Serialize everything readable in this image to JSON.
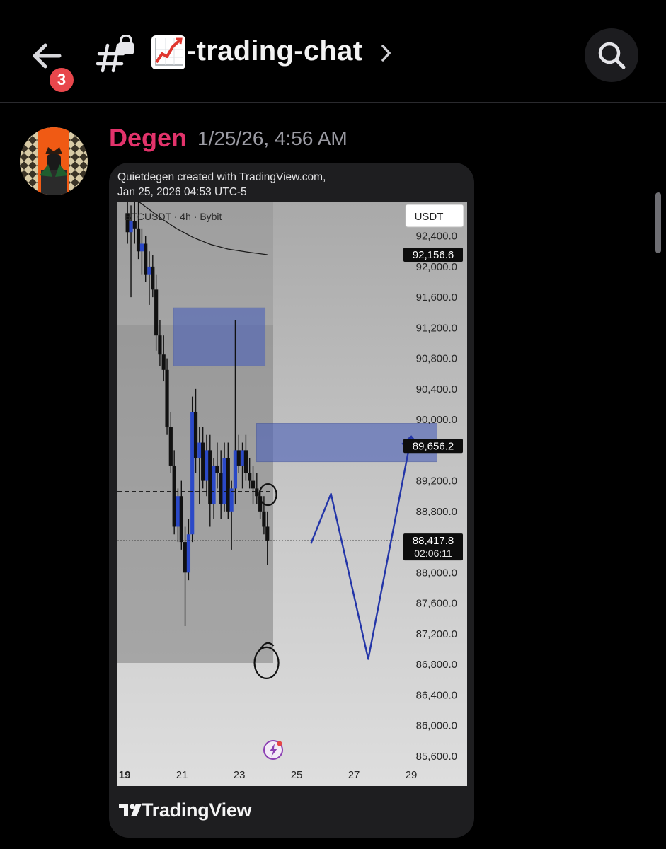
{
  "header": {
    "unread_count": "3",
    "channel_name": "-trading-chat",
    "channel_emoji": "chart-increasing-icon"
  },
  "message": {
    "author": "Degen",
    "timestamp": "1/25/26, 4:56 AM",
    "author_color": "#e2336b"
  },
  "embed": {
    "credit_line1": "Quietdegen created with TradingView.com,",
    "credit_line2": "Jan 25, 2026 04:53 UTC-5",
    "brand": "TradingView"
  },
  "chart_data": {
    "type": "candlestick",
    "symbol_line": "BTCUSDT · 4h · Bybit",
    "currency_button": "USDT",
    "y_ticks": [
      92400,
      92000,
      91600,
      91200,
      90800,
      90400,
      90000,
      89600,
      89200,
      88800,
      88000,
      87600,
      87200,
      86800,
      86400,
      86000,
      85600
    ],
    "y_tick_labels": [
      "92,400.0",
      "92,000.0",
      "91,600.0",
      "91,200.0",
      "90,800.0",
      "90,400.0",
      "90,000.0",
      "89,200.0",
      "88,800.0",
      "88,000.0",
      "87,600.0",
      "87,200.0",
      "86,800.0",
      "86,400.0",
      "86,000.0",
      "85,600.0"
    ],
    "x_labels": [
      "19",
      "21",
      "23",
      "25",
      "27",
      "29"
    ],
    "x_values": [
      19,
      21,
      23,
      25,
      27,
      29
    ],
    "ylim": [
      85450,
      92850
    ],
    "xlim": [
      18.75,
      30.95
    ],
    "moving_average_end": 92156.6,
    "price_labels": [
      {
        "value": "92,156.6",
        "price": 92156.6
      },
      {
        "value": "89,656.2",
        "price": 89656.2
      },
      {
        "value": "88,417.8",
        "price": 88417.8,
        "sub": "02:06:11"
      }
    ],
    "zones": [
      {
        "from_x": 20.7,
        "to_x": 23.9,
        "low": 90700,
        "high": 91460
      },
      {
        "from_x": 23.6,
        "to_x": 29.9,
        "low": 89450,
        "high": 89950
      }
    ],
    "dashed_level": 89060,
    "current_price": 88417.8,
    "projection": [
      [
        25.5,
        88380
      ],
      [
        26.2,
        89030
      ],
      [
        27.5,
        86870
      ],
      [
        29,
        89780
      ]
    ],
    "candles": [
      [
        19.1,
        92700,
        92900,
        92300,
        92450
      ],
      [
        19.22,
        92450,
        92800,
        91600,
        92600
      ],
      [
        19.35,
        92600,
        92900,
        92300,
        92500
      ],
      [
        19.48,
        92500,
        92900,
        92100,
        92200
      ],
      [
        19.6,
        92200,
        92500,
        91900,
        92300
      ],
      [
        19.73,
        92300,
        92400,
        91800,
        91900
      ],
      [
        19.86,
        91900,
        92200,
        91500,
        92000
      ],
      [
        19.98,
        92000,
        92150,
        91600,
        91700
      ],
      [
        20.1,
        91700,
        91900,
        90900,
        91100
      ],
      [
        20.23,
        91100,
        91300,
        90700,
        90850
      ],
      [
        20.36,
        90850,
        91100,
        90500,
        90650
      ],
      [
        20.48,
        90650,
        90800,
        89800,
        89900
      ],
      [
        20.61,
        89900,
        90100,
        89300,
        89400
      ],
      [
        20.73,
        89400,
        89600,
        88500,
        88600
      ],
      [
        20.86,
        88600,
        89100,
        88400,
        89000
      ],
      [
        20.98,
        89000,
        89200,
        88300,
        88400
      ],
      [
        21.11,
        88400,
        88600,
        87300,
        88000
      ],
      [
        21.23,
        88000,
        88700,
        87900,
        88500
      ],
      [
        21.36,
        88500,
        90300,
        88400,
        90100
      ],
      [
        21.48,
        90100,
        90400,
        89300,
        89500
      ],
      [
        21.61,
        89500,
        89900,
        88900,
        89700
      ],
      [
        21.73,
        89700,
        89900,
        89100,
        89200
      ],
      [
        21.86,
        89200,
        89800,
        89000,
        89600
      ],
      [
        21.98,
        89600,
        89800,
        88600,
        88900
      ],
      [
        22.11,
        88900,
        89500,
        88700,
        89400
      ],
      [
        22.23,
        89400,
        89700,
        89100,
        89300
      ],
      [
        22.36,
        89300,
        89600,
        88700,
        88900
      ],
      [
        22.48,
        88900,
        89700,
        88800,
        89500
      ],
      [
        22.61,
        89500,
        89700,
        88700,
        88800
      ],
      [
        22.73,
        88800,
        89200,
        88300,
        89100
      ],
      [
        22.86,
        89100,
        91300,
        88900,
        89600
      ],
      [
        22.98,
        89600,
        89800,
        89300,
        89400
      ],
      [
        23.11,
        89400,
        89700,
        89100,
        89600
      ],
      [
        23.23,
        89600,
        89800,
        89200,
        89300
      ],
      [
        23.36,
        89300,
        89500,
        89100,
        89200
      ],
      [
        23.48,
        89200,
        89400,
        88900,
        89100
      ],
      [
        23.61,
        89100,
        89300,
        88900,
        89000
      ],
      [
        23.73,
        89000,
        89100,
        88700,
        88800
      ],
      [
        23.86,
        88800,
        89000,
        88500,
        88600
      ],
      [
        23.98,
        88600,
        88800,
        88100,
        88420
      ]
    ]
  }
}
